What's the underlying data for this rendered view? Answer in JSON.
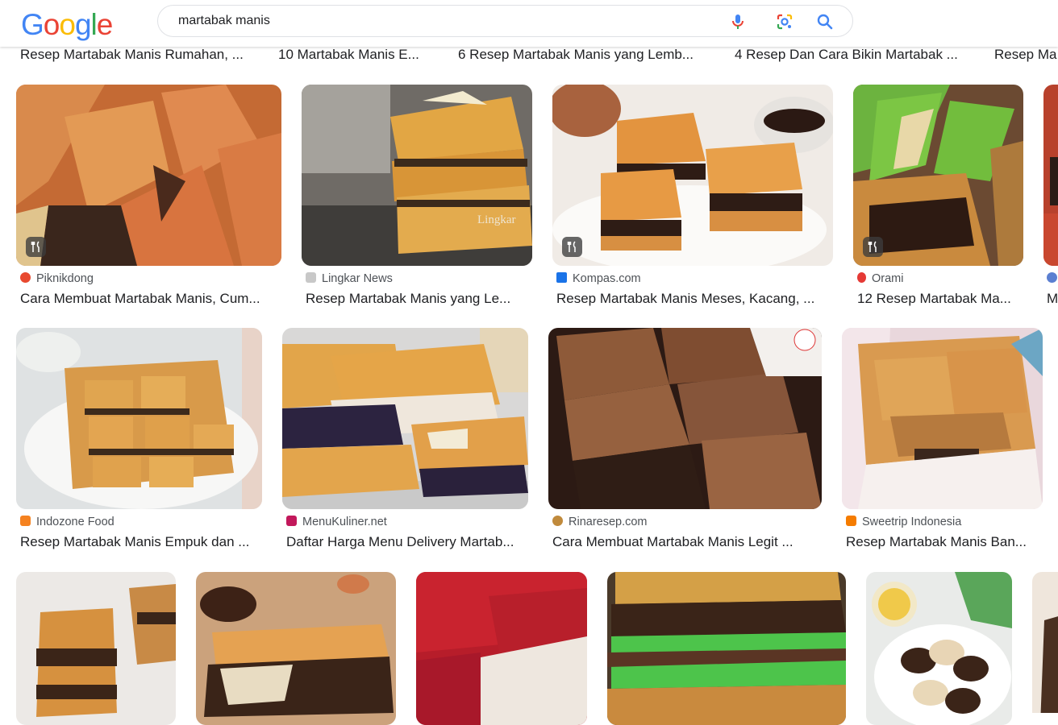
{
  "logo": {
    "letters": [
      "G",
      "o",
      "o",
      "g",
      "l",
      "e"
    ]
  },
  "search": {
    "query": "martabak manis"
  },
  "top_titles": [
    "Resep Martabak Manis Rumahan, ...",
    "10 Martabak Manis E...",
    "6 Resep Martabak Manis yang Lemb...",
    "4 Resep Dan Cara Bikin Martabak ...",
    "Resep Ma"
  ],
  "row1": [
    {
      "source": "Piknikdong",
      "title": "Cara Membuat Martabak Manis, Cum...",
      "recipe_badge": true
    },
    {
      "source": "Lingkar News",
      "title": "Resep Martabak Manis yang Le...",
      "recipe_badge": false,
      "watermark": "Lingkar"
    },
    {
      "source": "Kompas.com",
      "title": "Resep Martabak Manis Meses, Kacang, ...",
      "recipe_badge": true
    },
    {
      "source": "Orami",
      "title": "12 Resep Martabak Ma...",
      "recipe_badge": true
    },
    {
      "source": "",
      "title": "M",
      "recipe_badge": false
    }
  ],
  "row2": [
    {
      "source": "Indozone Food",
      "title": "Resep Martabak Manis Empuk dan ..."
    },
    {
      "source": "MenuKuliner.net",
      "title": "Daftar Harga Menu Delivery Martab..."
    },
    {
      "source": "Rinaresep.com",
      "title": "Cara Membuat Martabak Manis Legit ..."
    },
    {
      "source": "Sweetrip Indonesia",
      "title": "Resep Martabak Manis Ban..."
    }
  ],
  "colors": {
    "google_blue": "#4285F4",
    "google_red": "#EA4335",
    "google_yellow": "#FBBC05",
    "google_green": "#34A853",
    "text": "#202124",
    "source_text": "#4d5156"
  }
}
